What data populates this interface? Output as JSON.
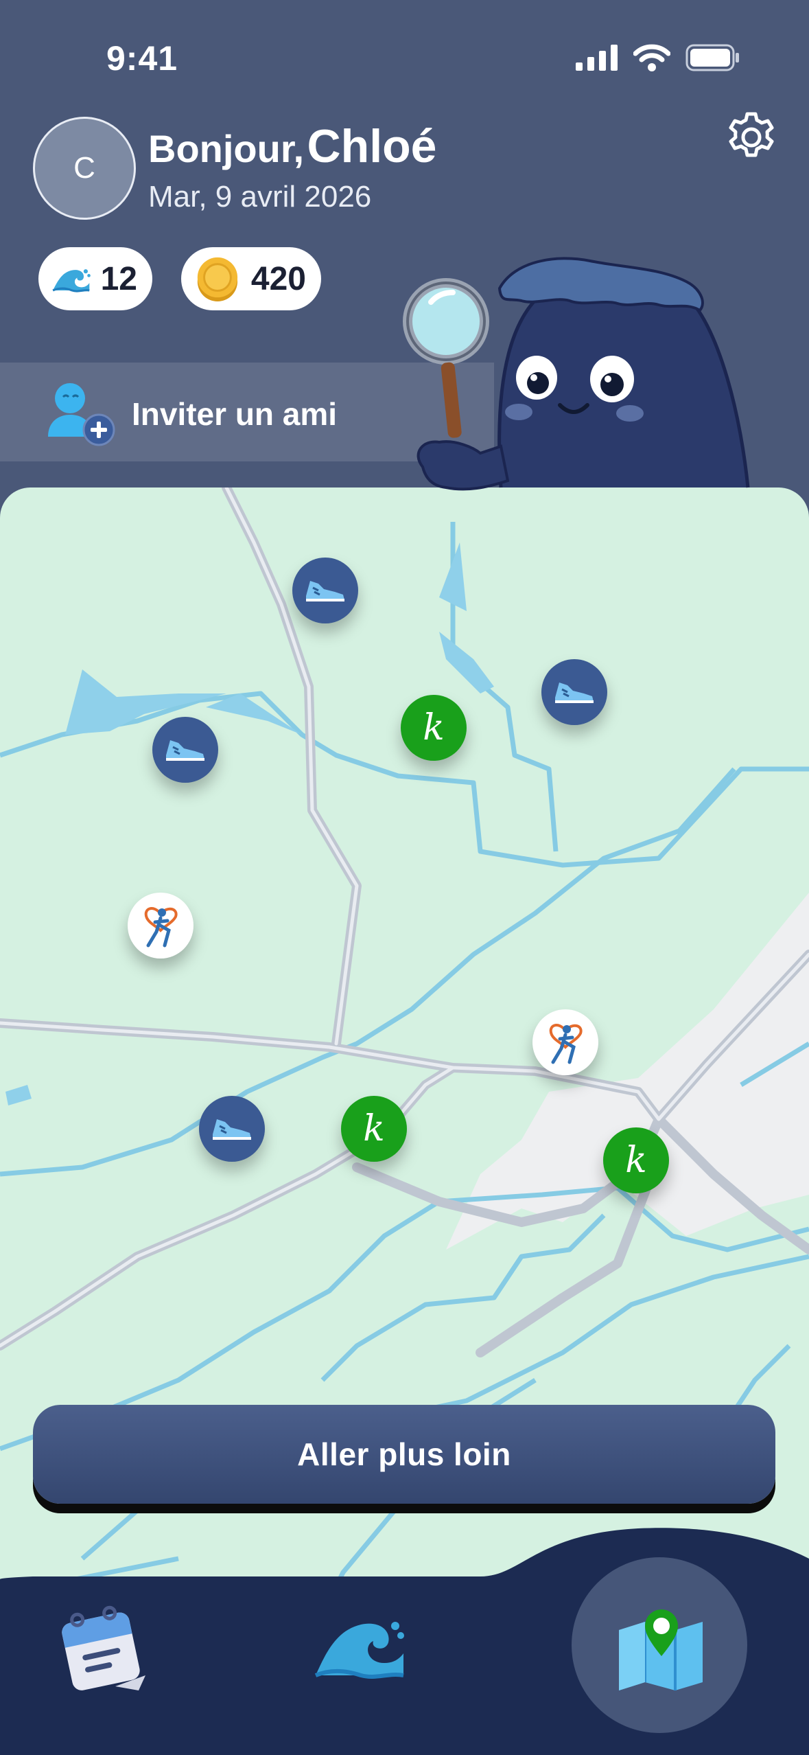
{
  "status_bar": {
    "time": "9:41"
  },
  "header": {
    "avatar_initial": "C",
    "greeting_prefix": "Bonjour,",
    "user_name": "Chloé",
    "date": "Mar, 9 avril 2026"
  },
  "stats": {
    "waves": "12",
    "coins": "420"
  },
  "invite": {
    "label": "Inviter un ami"
  },
  "map": {
    "pins": [
      {
        "type": "shoe-icon"
      },
      {
        "type": "shoe-icon"
      },
      {
        "type": "shoe-icon"
      },
      {
        "type": "shoe-icon"
      },
      {
        "type": "k",
        "label": "k"
      },
      {
        "type": "k",
        "label": "k"
      },
      {
        "type": "k",
        "label": "k"
      },
      {
        "type": "runner-logo-icon"
      },
      {
        "type": "runner-logo-icon"
      }
    ]
  },
  "cta": {
    "label": "Aller plus loin"
  },
  "tabbar": {
    "tabs": [
      "calendar-icon",
      "waves-icon",
      "map-icon"
    ],
    "active": "map-icon"
  },
  "colors": {
    "header_bg": "#4a5878",
    "map_bg": "#d5f1e1",
    "tabbar_bg": "#1c2b52",
    "k_pin": "#19a01b",
    "shoe_pin": "#3b5a93"
  }
}
